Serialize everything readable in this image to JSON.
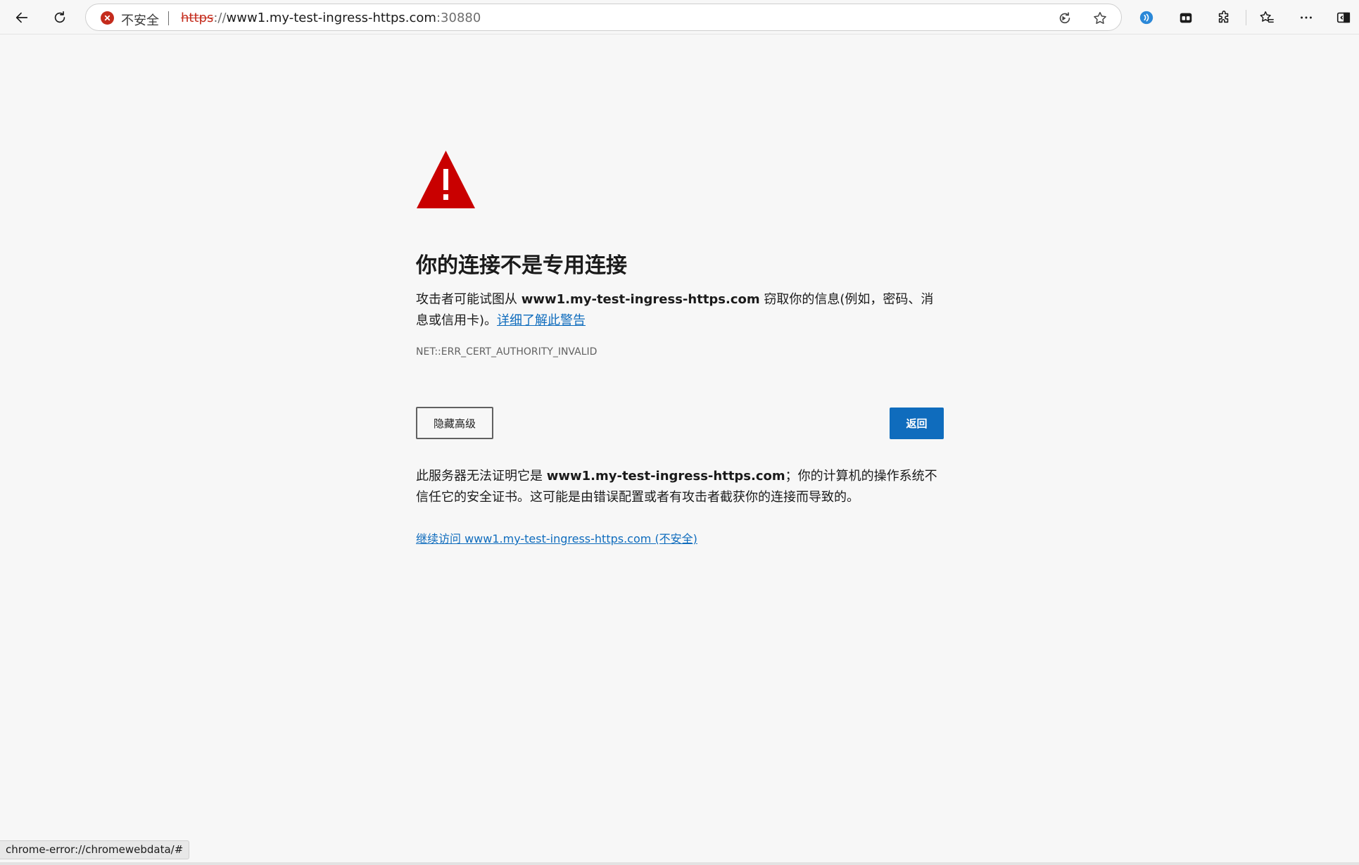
{
  "toolbar": {
    "back_icon": "back-arrow-icon",
    "refresh_icon": "refresh-icon",
    "security_status": "不安全",
    "url": {
      "scheme": "https",
      "separator": "://",
      "host": "www1.my-test-ingress-https.com",
      "port": ":30880"
    },
    "right_icons": [
      "read-aloud-icon",
      "favorites-star-icon",
      "copilot-icon",
      "workspaces-icon",
      "extensions-icon",
      "favorites-icon",
      "more-icon",
      "split-screen-icon"
    ]
  },
  "error_page": {
    "heading": "你的连接不是专用连接",
    "description_prefix": "攻击者可能试图从 ",
    "description_host": "www1.my-test-ingress-https.com",
    "description_suffix": " 窃取你的信息(例如，密码、消息或信用卡)。",
    "learn_more_link": "详细了解此警告",
    "error_code": "NET::ERR_CERT_AUTHORITY_INVALID",
    "hide_advanced_button": "隐藏高级",
    "back_button": "返回",
    "advanced_prefix": "此服务器无法证明它是 ",
    "advanced_host": "www1.my-test-ingress-https.com",
    "advanced_suffix": "；你的计算机的操作系统不信任它的安全证书。这可能是由错误配置或者有攻击者截获你的连接而导致的。",
    "proceed_link": "继续访问 www1.my-test-ingress-https.com (不安全)"
  },
  "status_bar": {
    "text": "chrome-error://chromewebdata/#"
  },
  "colors": {
    "danger": "#c42b1c",
    "primary": "#0f6cbd",
    "background": "#f7f7f7"
  }
}
